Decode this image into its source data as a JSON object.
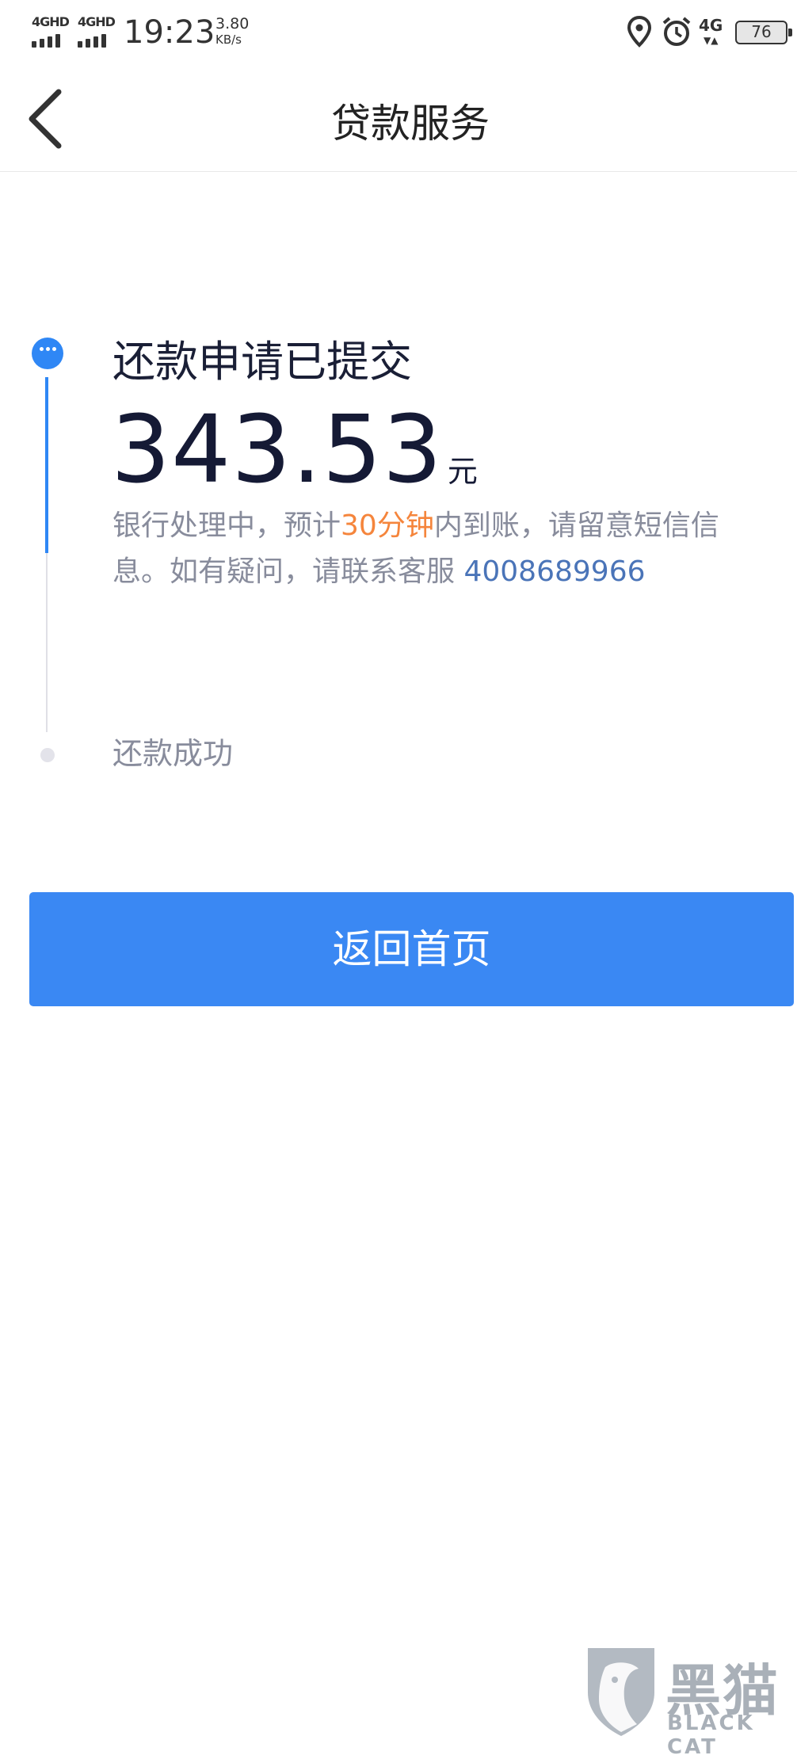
{
  "status_bar": {
    "signal_1": "4GHD",
    "signal_2": "4GHD",
    "time": "19:23",
    "speed_value": "3.80",
    "speed_unit": "KB/s",
    "network": "4G",
    "battery": "76",
    "icons": [
      "location-icon",
      "alarm-icon"
    ]
  },
  "header": {
    "title": "贷款服务"
  },
  "progress": {
    "step1_title": "还款申请已提交",
    "amount": "343.53",
    "currency": "元",
    "desc_part1": "银行处理中，预计",
    "desc_highlight": "30分钟",
    "desc_part2": "内到账，请留意短信信息。如有疑问，请联系客服 ",
    "phone": "4008689966",
    "step2_title": "还款成功"
  },
  "button": {
    "label": "返回首页"
  },
  "watermark": {
    "cn": "黑猫",
    "en": "BLACK CAT"
  },
  "colors": {
    "primary": "#3a88f3",
    "highlight": "#f5853c",
    "phone": "#4a74b8"
  }
}
